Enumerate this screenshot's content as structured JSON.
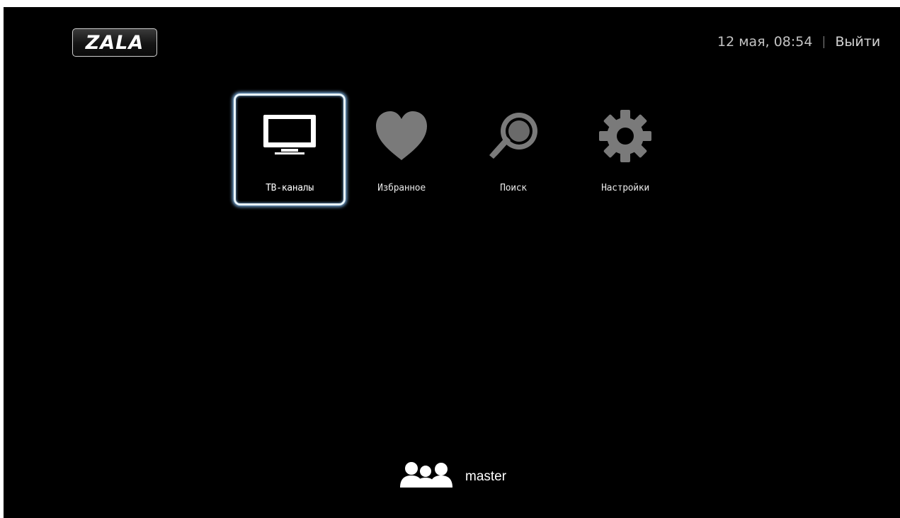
{
  "header": {
    "logo_text": "ZALA",
    "datetime": "12 мая, 08:54",
    "logout_label": "Выйти"
  },
  "menu": {
    "items": [
      {
        "label": "ТВ-каналы",
        "icon": "tv-icon",
        "selected": true
      },
      {
        "label": "Избранное",
        "icon": "heart-icon",
        "selected": false
      },
      {
        "label": "Поиск",
        "icon": "magnifier-icon",
        "selected": false
      },
      {
        "label": "Настройки",
        "icon": "gear-icon",
        "selected": false
      }
    ]
  },
  "user": {
    "name": "master",
    "icon": "users-icon"
  },
  "colors": {
    "background": "#000000",
    "icon_inactive": "#7a7a7a",
    "icon_active": "#ffffff",
    "selection_border": "#eaf7ff",
    "selection_glow": "#8cc8ff"
  }
}
